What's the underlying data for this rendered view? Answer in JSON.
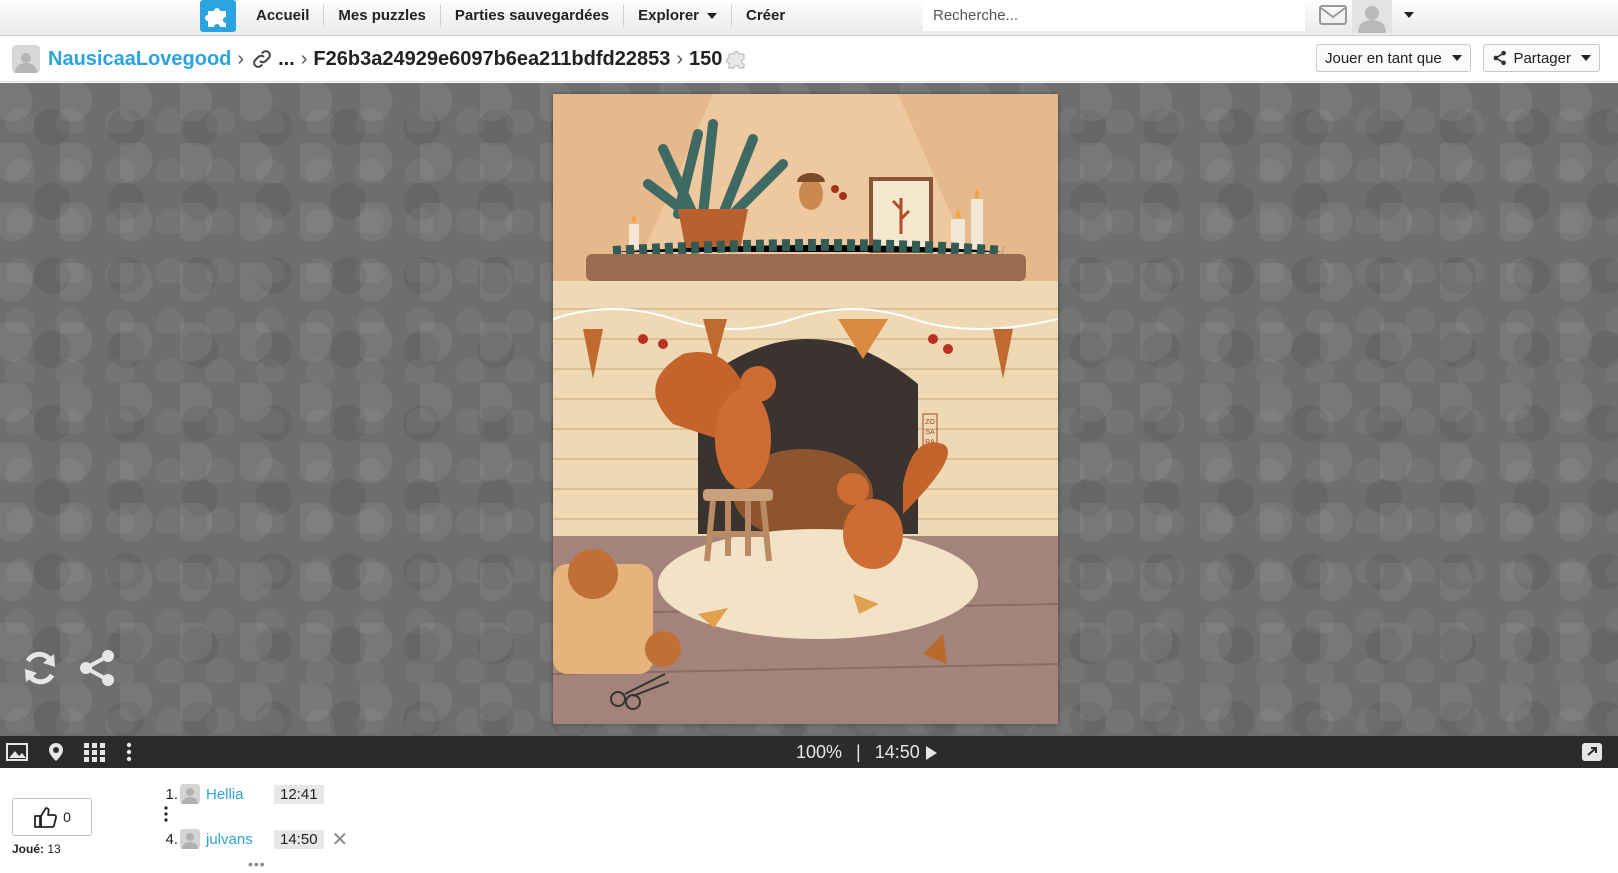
{
  "nav": {
    "links": [
      {
        "label": "Accueil"
      },
      {
        "label": "Mes puzzles"
      },
      {
        "label": "Parties sauvegardées"
      },
      {
        "label": "Explorer",
        "has_caret": true
      },
      {
        "label": "Créer"
      }
    ],
    "search_placeholder": "Recherche..."
  },
  "breadcrumb": {
    "user": "NausicaaLovegood",
    "ellipsis": "...",
    "puzzle_id": "F26b3a24929e6097b6ea211bdfd22853",
    "piece_count": "150"
  },
  "actions": {
    "play_as_label": "Jouer en tant que",
    "share_label": "Partager"
  },
  "controls": {
    "zoom": "100%",
    "divider": "|",
    "timer": "14:50"
  },
  "like": {
    "count": "0"
  },
  "played": {
    "label": "Joué:",
    "count": "13"
  },
  "scores": [
    {
      "rank": "1.",
      "player": "Hellia",
      "time": "12:41"
    },
    {
      "rank": "4.",
      "player": "julvans",
      "time": "14:50",
      "removable": true
    }
  ],
  "more": "•••",
  "image_signature": [
    "ZO",
    "SA",
    "RA"
  ],
  "colors": {
    "accent": "#2aa3df",
    "board": "#6e6e6e",
    "control_bar": "#2b2b2b"
  }
}
